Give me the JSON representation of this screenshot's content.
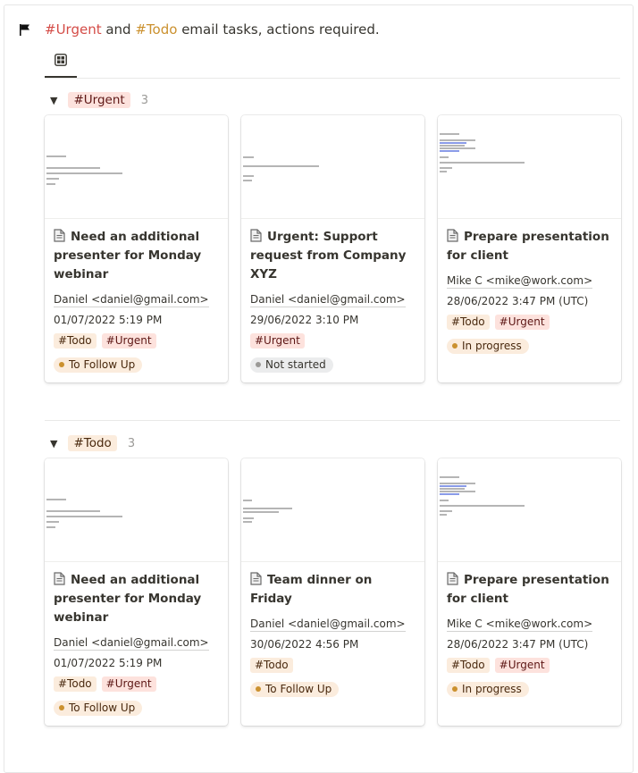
{
  "header": {
    "icon": "flag-icon",
    "title_urgent": "#Urgent",
    "title_and": " and ",
    "title_todo": "#Todo",
    "title_rest": " email tasks, actions required."
  },
  "tabs": [
    {
      "icon": "gallery-icon",
      "active": true
    }
  ],
  "colors": {
    "urgent_text": "#d44c47",
    "todo_text": "#cb912f",
    "urgent_bg": "#fde2dd",
    "todo_bg": "#fbecdd",
    "status_orange_dot": "#cb912f",
    "status_gray_dot": "#9b9a97"
  },
  "groups": [
    {
      "label": "#Urgent",
      "count": "3",
      "cards": [
        {
          "title": "Need an additional presenter for Monday webinar",
          "sender": "Daniel <daniel@gmail.com>",
          "date": "01/07/2022 5:19 PM",
          "tags": [
            "#Todo",
            "#Urgent"
          ],
          "status": "To Follow Up"
        },
        {
          "title": "Urgent: Support request from Company XYZ",
          "sender": "Daniel <daniel@gmail.com>",
          "date": "29/06/2022 3:10 PM",
          "tags": [
            "#Urgent"
          ],
          "status": "Not started"
        },
        {
          "title": "Prepare presentation for client",
          "sender": "Mike C <mike@work.com>",
          "date": "28/06/2022 3:47 PM (UTC)",
          "tags": [
            "#Todo",
            "#Urgent"
          ],
          "status": "In progress"
        }
      ]
    },
    {
      "label": "#Todo",
      "count": "3",
      "cards": [
        {
          "title": "Need an additional presenter for Monday webinar",
          "sender": "Daniel <daniel@gmail.com>",
          "date": "01/07/2022 5:19 PM",
          "tags": [
            "#Todo",
            "#Urgent"
          ],
          "status": "To Follow Up"
        },
        {
          "title": "Team dinner on Friday",
          "sender": "Daniel <daniel@gmail.com>",
          "date": "30/06/2022 4:56 PM",
          "tags": [
            "#Todo"
          ],
          "status": "To Follow Up"
        },
        {
          "title": "Prepare presentation for client",
          "sender": "Mike C <mike@work.com>",
          "date": "28/06/2022 3:47 PM (UTC)",
          "tags": [
            "#Todo",
            "#Urgent"
          ],
          "status": "In progress"
        }
      ]
    }
  ]
}
